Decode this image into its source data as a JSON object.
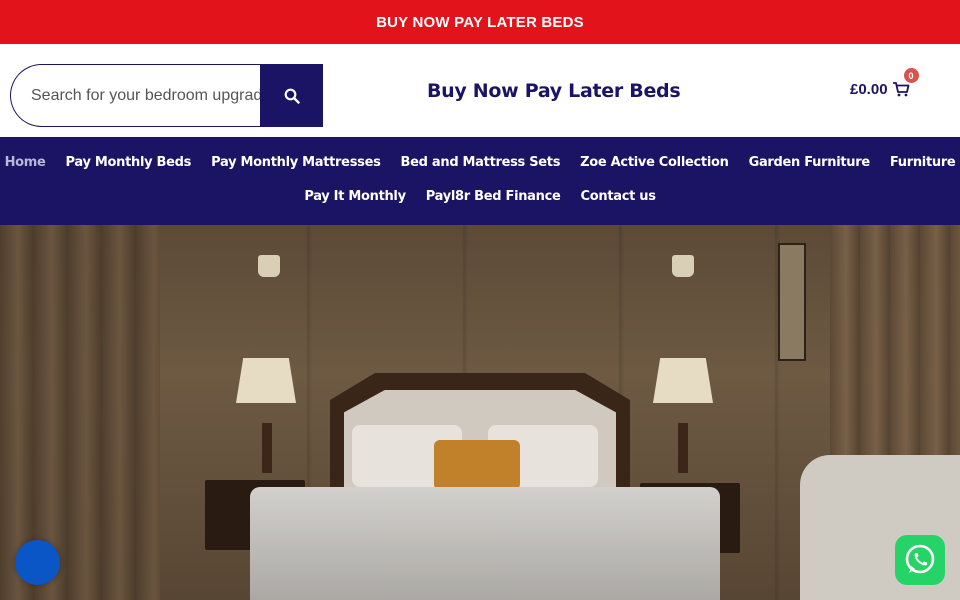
{
  "topbar": {
    "promo_text": "BUY NOW PAY LATER BEDS"
  },
  "header": {
    "search_placeholder": "Search for your bedroom upgrade",
    "site_title": "Buy Now Pay Later Beds",
    "cart_amount": "£0.00",
    "cart_count": "0"
  },
  "nav": {
    "row1": [
      {
        "label": "Home",
        "active": true
      },
      {
        "label": "Pay Monthly Beds"
      },
      {
        "label": "Pay Monthly Mattresses"
      },
      {
        "label": "Bed and Mattress Sets"
      },
      {
        "label": "Zoe Active Collection"
      },
      {
        "label": "Garden Furniture"
      },
      {
        "label": "Furniture"
      }
    ],
    "row2": [
      {
        "label": "Pay It Monthly"
      },
      {
        "label": "Payl8r Bed Finance"
      },
      {
        "label": "Contact us"
      }
    ]
  },
  "colors": {
    "promo_red": "#e3131b",
    "brand_navy": "#1b1464",
    "whatsapp_green": "#25d366",
    "chat_blue": "#0a56c7"
  },
  "icons": {
    "search": "search-icon",
    "cart": "cart-icon",
    "whatsapp": "whatsapp-icon",
    "chat": "chat-icon"
  }
}
